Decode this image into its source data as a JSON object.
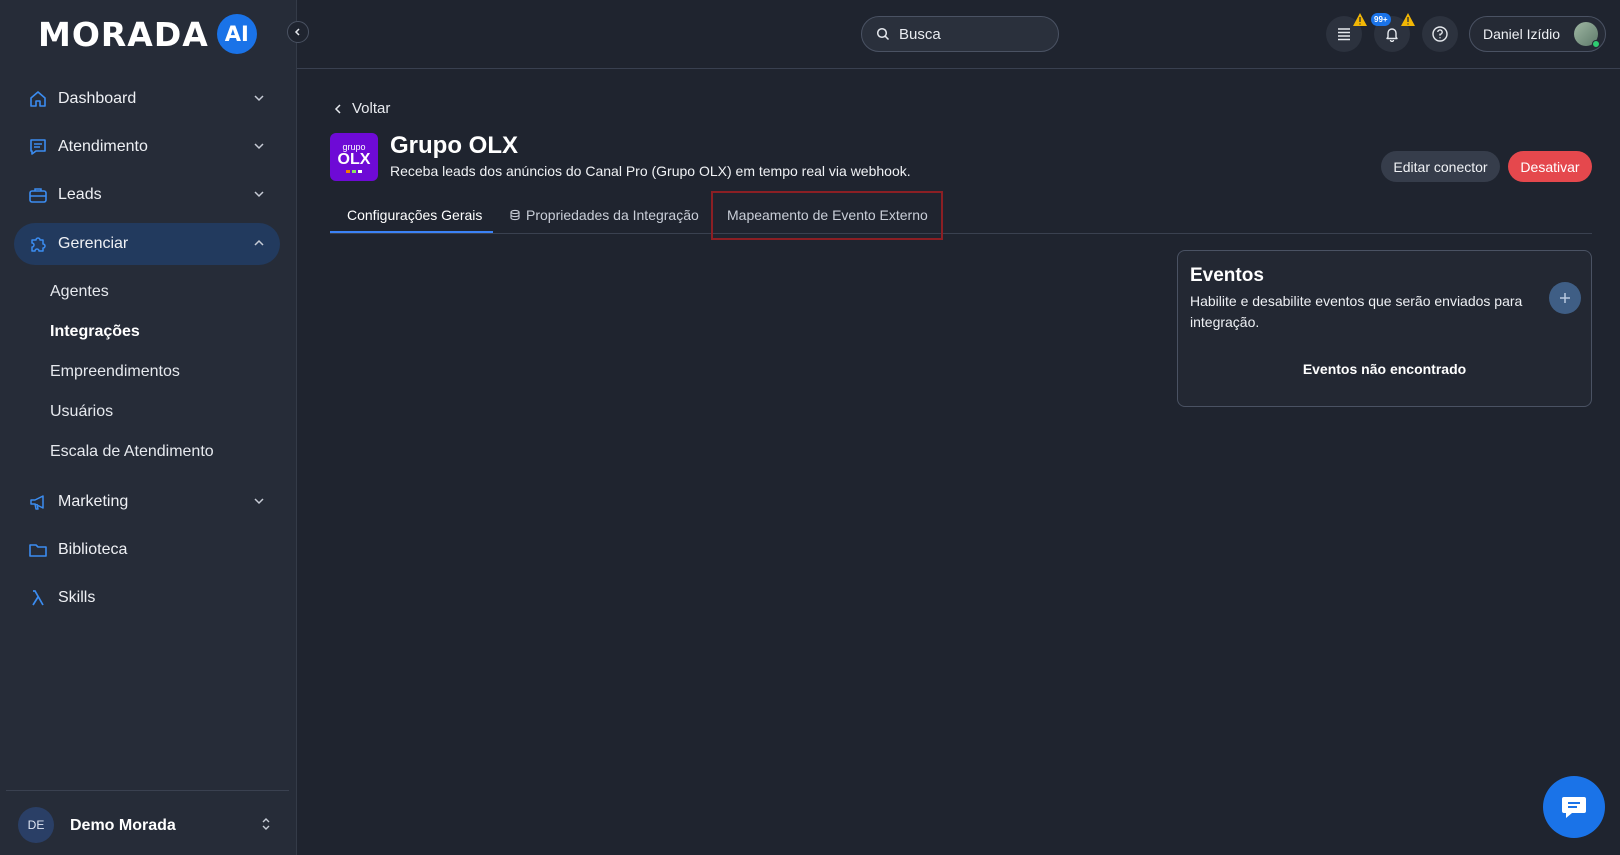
{
  "brand": {
    "logo_text": "MORADA",
    "logo_ai": "AI"
  },
  "sidebar": {
    "items": [
      {
        "label": "Dashboard",
        "icon": "home-icon"
      },
      {
        "label": "Atendimento",
        "icon": "message-icon"
      },
      {
        "label": "Leads",
        "icon": "briefcase-icon"
      },
      {
        "label": "Gerenciar",
        "icon": "puzzle-icon"
      },
      {
        "label": "Marketing",
        "icon": "megaphone-icon"
      },
      {
        "label": "Biblioteca",
        "icon": "folder-icon"
      },
      {
        "label": "Skills",
        "icon": "lambda-icon"
      }
    ],
    "subitems": [
      {
        "label": "Agentes"
      },
      {
        "label": "Integrações"
      },
      {
        "label": "Empreendimentos"
      },
      {
        "label": "Usuários"
      },
      {
        "label": "Escala de Atendimento"
      }
    ],
    "footer": {
      "initials": "DE",
      "org_name": "Demo Morada"
    }
  },
  "topbar": {
    "search_label": "Busca",
    "notifications_count": "99+",
    "user_name": "Daniel Izídio"
  },
  "page": {
    "back_label": "Voltar",
    "logo_top": "grupo",
    "logo_main": "OLX",
    "title": "Grupo OLX",
    "description": "Receba leads dos anúncios do Canal Pro (Grupo OLX) em tempo real via webhook.",
    "edit_label": "Editar conector",
    "deactivate_label": "Desativar",
    "tabs": [
      {
        "label": "Configurações Gerais"
      },
      {
        "label": "Propriedades da Integração"
      },
      {
        "label": "Mapeamento de Evento Externo"
      }
    ]
  },
  "events": {
    "title": "Eventos",
    "description": "Habilite e desabilite eventos que serão enviados para integração.",
    "empty": "Eventos não encontrado"
  },
  "colors": {
    "accent": "#1a73e8",
    "danger": "#e5484d",
    "active_nav": "#223a5e",
    "highlight_box": "#8b1f24"
  }
}
